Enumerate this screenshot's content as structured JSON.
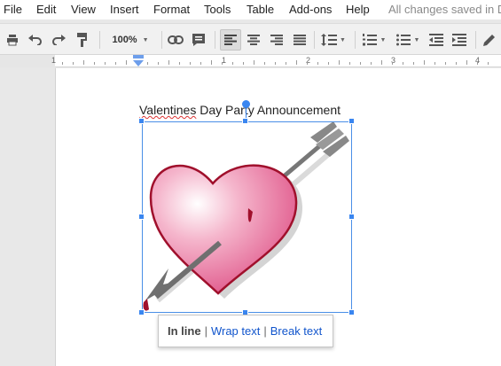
{
  "menu": {
    "items": [
      "File",
      "Edit",
      "View",
      "Insert",
      "Format",
      "Tools",
      "Table",
      "Add-ons",
      "Help"
    ],
    "status": "All changes saved in Drive"
  },
  "toolbar": {
    "zoom": "100%",
    "icons": [
      "print-icon",
      "undo-icon",
      "redo-icon",
      "paint-format-icon",
      "link-icon",
      "comment-icon",
      "align-left-icon",
      "align-center-icon",
      "align-right-icon",
      "justify-icon",
      "line-spacing-icon",
      "numbered-list-icon",
      "bulleted-list-icon",
      "decrease-indent-icon",
      "increase-indent-icon",
      "edit-pencil-icon"
    ]
  },
  "ruler": {
    "numbers": [
      "1",
      "1",
      "2",
      "3",
      "4"
    ]
  },
  "document": {
    "title_first": "Valentines",
    "title_rest": " Day Party Announcement",
    "image_subject": "heart-pierced-by-arrow"
  },
  "popup": {
    "inline": "In line",
    "sep": "|",
    "wrap": "Wrap text",
    "break": "Break text"
  },
  "colors": {
    "selection": "#3a86f0",
    "link": "#1155cc",
    "heart_fill": "#e8608f",
    "heart_outline": "#a0102c"
  }
}
